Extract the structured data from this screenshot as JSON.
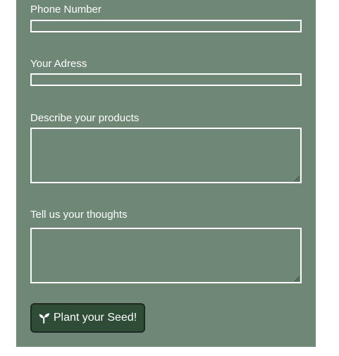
{
  "form": {
    "fields": [
      {
        "label": "Phone Number",
        "type": "input",
        "value": ""
      },
      {
        "label": "Your Adress",
        "type": "input",
        "value": ""
      },
      {
        "label": "Describe your products",
        "type": "textarea",
        "value": ""
      },
      {
        "label": "Tell us your thoughts",
        "type": "textarea",
        "value": ""
      }
    ],
    "submit": {
      "label": "Plant your Seed!",
      "icon": "seedling-icon"
    }
  },
  "colors": {
    "panel_background": "#6e8875",
    "field_border": "#ffffff",
    "label_text": "#ffffff",
    "button_background": "#2f4d36",
    "button_border": "#1e2a21",
    "page_background": "#ffffff"
  }
}
